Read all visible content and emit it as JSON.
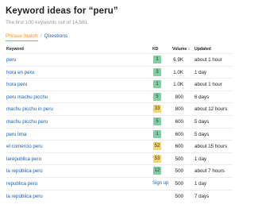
{
  "title": "Keyword ideas for “peru”",
  "subtitle": "The first 100 keywords out of 14,561",
  "tabs": {
    "active": "Phrase match",
    "separator": "/",
    "other": "Questions"
  },
  "columns": {
    "keyword": "Keyword",
    "kd": "KD",
    "volume": "Volume ↓",
    "updated": "Updated"
  },
  "colors": {
    "kd_green": "#80cfa3",
    "kd_yellow": "#f3d56a",
    "link": "#1a5fb4",
    "accent": "#ff8c1a"
  },
  "rows": [
    {
      "keyword": "peru",
      "kd": "1",
      "kd_color": "#80cfa3",
      "volume": "6.9K",
      "updated": "about 1 hour"
    },
    {
      "keyword": "hora en peru",
      "kd": "3",
      "kd_color": "#80cfa3",
      "volume": "1.0K",
      "updated": "1 day"
    },
    {
      "keyword": "hora peru",
      "kd": "1",
      "kd_color": "#80cfa3",
      "volume": "1.0K",
      "updated": "about 1 hour"
    },
    {
      "keyword": "peru machu picchu",
      "kd": "5",
      "kd_color": "#80cfa3",
      "volume": "800",
      "updated": "6 days"
    },
    {
      "keyword": "machu picchu in peru",
      "kd": "33",
      "kd_color": "#f3d56a",
      "volume": "800",
      "updated": "about 12 hours"
    },
    {
      "keyword": "machu picchu peru",
      "kd": "5",
      "kd_color": "#80cfa3",
      "volume": "600",
      "updated": "5 days"
    },
    {
      "keyword": "peru lima",
      "kd": "1",
      "kd_color": "#80cfa3",
      "volume": "600",
      "updated": "5 days"
    },
    {
      "keyword": "el comercio peru",
      "kd": "52",
      "kd_color": "#f3d56a",
      "volume": "600",
      "updated": "about 15 hours"
    },
    {
      "keyword": "larepublica peru",
      "kd": "53",
      "kd_color": "#f3d56a",
      "volume": "500",
      "updated": "1 day"
    },
    {
      "keyword": "la república perú",
      "kd": "12",
      "kd_color": "#80cfa3",
      "volume": "500",
      "updated": "about 7 hours"
    },
    {
      "keyword": "republica peru",
      "kd": "Sign up",
      "kd_color": "",
      "volume": "500",
      "updated": "1 day"
    },
    {
      "keyword": "la república peru",
      "kd": "",
      "kd_color": "",
      "volume": "500",
      "updated": "7 days"
    }
  ]
}
